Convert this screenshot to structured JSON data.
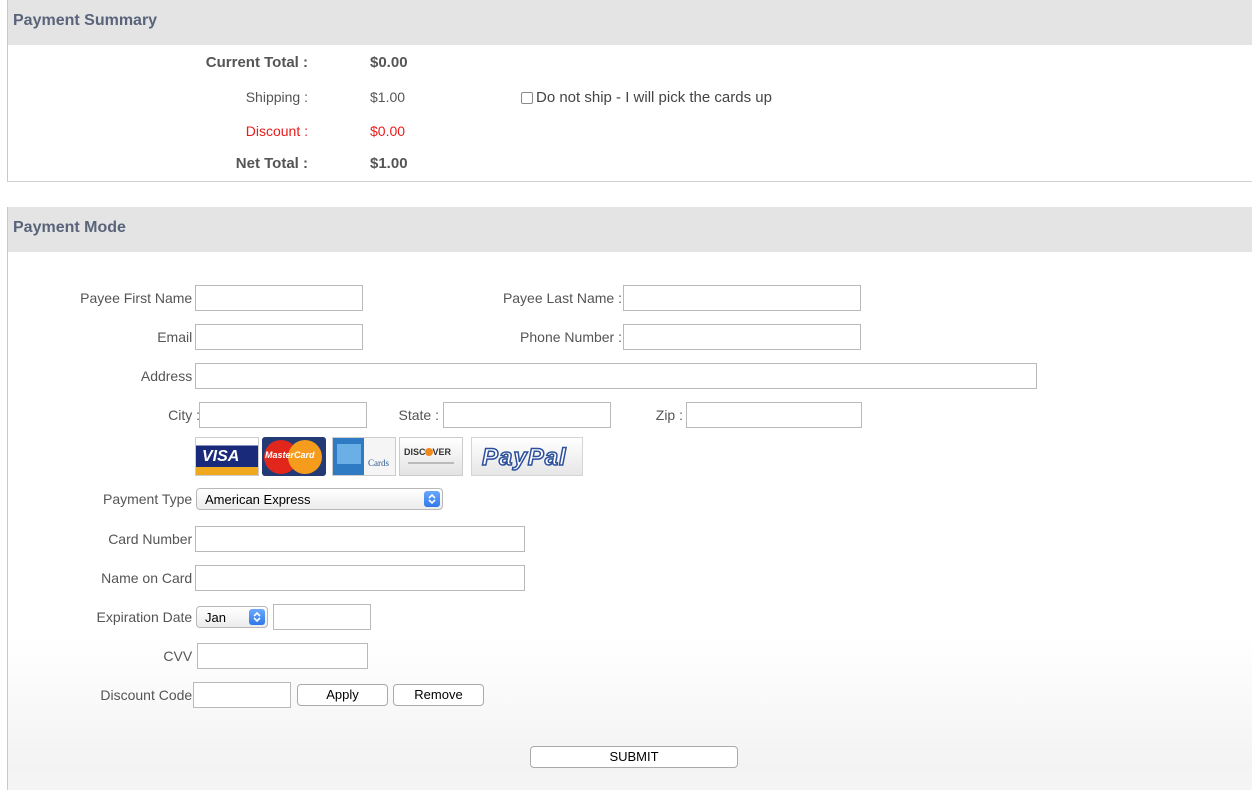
{
  "summary": {
    "title": "Payment Summary",
    "current_total_label": "Current Total :",
    "current_total_value": "$0.00",
    "shipping_label": "Shipping :",
    "shipping_value": "$1.00",
    "pickup_checkbox_label": "Do not ship - I will pick the cards up",
    "pickup_checked": false,
    "discount_label": "Discount :",
    "discount_value": "$0.00",
    "net_total_label": "Net Total :",
    "net_total_value": "$1.00",
    "discount_color": "#e81c1c"
  },
  "mode": {
    "title": "Payment Mode",
    "first_name_label": "Payee First Name :",
    "last_name_label": "Payee Last Name :",
    "email_label": "Email :",
    "phone_label": "Phone Number :",
    "address_label": "Address :",
    "city_label": "City :",
    "state_label": "State :",
    "zip_label": "Zip :",
    "card_logos": {
      "visa": "VISA",
      "mastercard": "MasterCard",
      "amex": "Cards",
      "discover": "DISCOVER",
      "paypal": "PayPal"
    },
    "payment_type_label": "Payment Type :",
    "payment_type_value": "American Express",
    "card_number_label": "Card Number :",
    "name_on_card_label": "Name on Card :",
    "expiration_label": "Expiration Date :",
    "expiration_month_value": "Jan",
    "cvv_label": "CVV :",
    "discount_code_label": "Discount Code :",
    "apply_label": "Apply",
    "remove_label": "Remove",
    "submit_label": "SUBMIT"
  },
  "colors": {
    "header_bg": "#e4e4e4",
    "header_text": "#59647a",
    "select_arrow": "#3b82f0"
  }
}
